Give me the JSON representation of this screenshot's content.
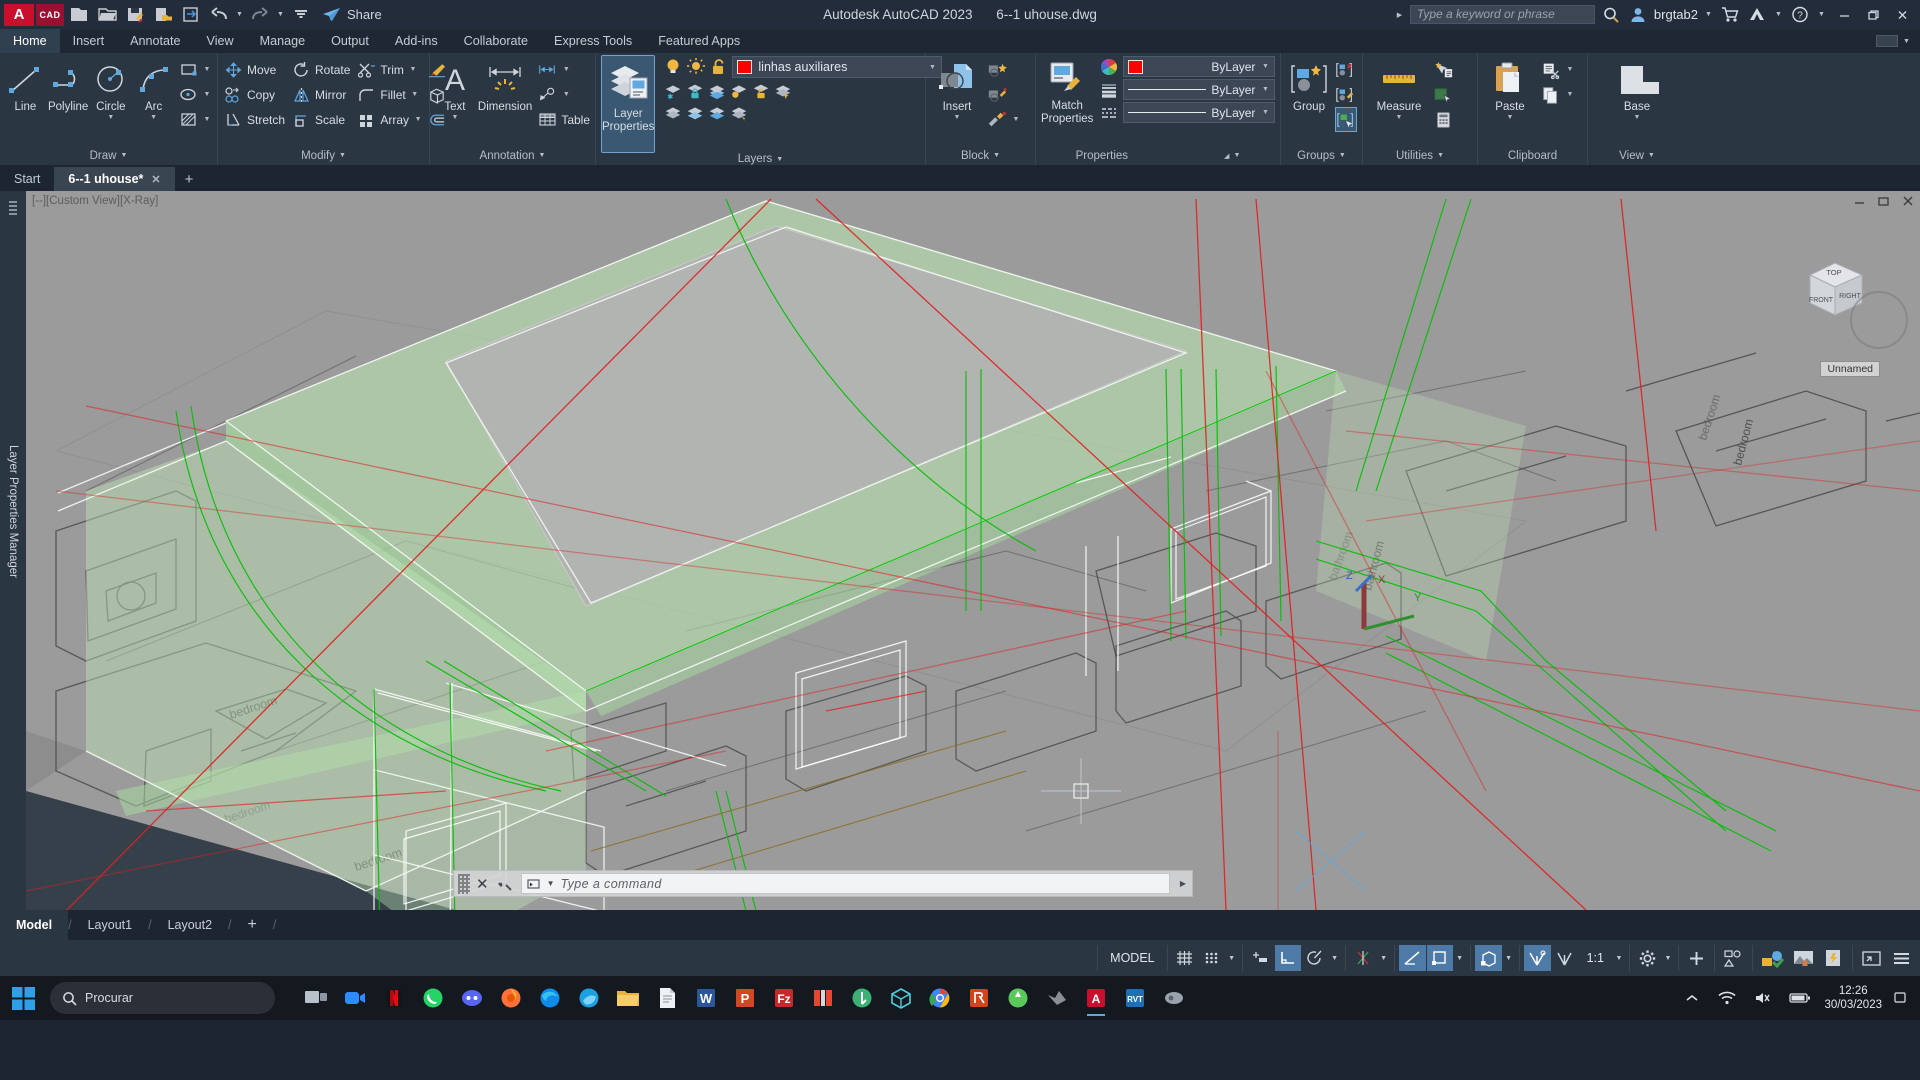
{
  "titlebar": {
    "logo": "A",
    "logo_cad": "CAD",
    "quick_access": [
      {
        "name": "new-file-icon",
        "label": "New"
      },
      {
        "name": "open-file-icon",
        "label": "Open"
      },
      {
        "name": "save-icon",
        "label": "Save"
      },
      {
        "name": "save-as-icon",
        "label": "Save As"
      },
      {
        "name": "plot-icon",
        "label": "Plot"
      },
      {
        "name": "undo-icon",
        "label": "Undo"
      },
      {
        "name": "redo-icon",
        "label": "Redo"
      },
      {
        "name": "qat-more-icon",
        "label": "Customize Quick Access Toolbar"
      }
    ],
    "share_label": "Share",
    "app_title": "Autodesk AutoCAD 2023",
    "document_name": "6--1 uhouse.dwg",
    "search_placeholder": "Type a keyword or phrase",
    "username": "brgtab2",
    "window_buttons": [
      "minimize",
      "restore",
      "close"
    ]
  },
  "ribbon_tabs": {
    "items": [
      "Home",
      "Insert",
      "Annotate",
      "View",
      "Manage",
      "Output",
      "Add-ins",
      "Collaborate",
      "Express Tools",
      "Featured Apps"
    ],
    "active": "Home"
  },
  "ribbon": {
    "panels": [
      {
        "title": "Draw",
        "big": [
          {
            "label": "Line",
            "icon": "line-icon",
            "dropdown": false
          },
          {
            "label": "Polyline",
            "icon": "polyline-icon",
            "dropdown": false
          },
          {
            "label": "Circle",
            "icon": "circle-icon",
            "dropdown": true
          },
          {
            "label": "Arc",
            "icon": "arc-icon",
            "dropdown": true
          }
        ],
        "small": [
          {
            "label": "",
            "icon": "rectangle-icon",
            "dropdown": true
          },
          {
            "label": "",
            "icon": "ellipse-icon",
            "dropdown": true
          },
          {
            "label": "",
            "icon": "hatch-icon",
            "dropdown": true
          }
        ]
      },
      {
        "title": "Modify",
        "small": [
          {
            "label": "Move",
            "icon": "move-icon"
          },
          {
            "label": "Rotate",
            "icon": "rotate-icon"
          },
          {
            "label": "Trim",
            "icon": "trim-icon",
            "dropdown": true
          },
          {
            "label": "Copy",
            "icon": "copy-icon"
          },
          {
            "label": "Mirror",
            "icon": "mirror-icon"
          },
          {
            "label": "Fillet",
            "icon": "fillet-icon",
            "dropdown": true
          },
          {
            "label": "Stretch",
            "icon": "stretch-icon"
          },
          {
            "label": "Scale",
            "icon": "scale-icon"
          },
          {
            "label": "Array",
            "icon": "array-icon",
            "dropdown": true
          }
        ],
        "extra": [
          {
            "label": "",
            "icon": "brush-icon"
          },
          {
            "label": "",
            "icon": "3d-box-icon"
          },
          {
            "label": "",
            "icon": "offset-icon"
          }
        ]
      },
      {
        "title": "Annotation",
        "big": [
          {
            "label": "Text",
            "icon": "text-icon",
            "dropdown": true
          },
          {
            "label": "Dimension",
            "icon": "dimension-icon",
            "dropdown": false
          }
        ],
        "small": [
          {
            "label": "",
            "icon": "linear-dim-icon",
            "dropdown": true
          },
          {
            "label": "",
            "icon": "leader-icon",
            "dropdown": true
          },
          {
            "label": "Table",
            "icon": "table-icon"
          }
        ]
      },
      {
        "title": "Layers",
        "big": [
          {
            "label": "Layer Properties",
            "icon": "layer-properties-icon",
            "active": true
          }
        ],
        "layer_combo": {
          "color": "#ff0000",
          "name": "linhas auxiliares",
          "toggles": [
            "lightbulb-on-icon",
            "sun-icon",
            "unlock-icon"
          ]
        },
        "layer_tools": [
          "layer-freeze-icon",
          "layer-lock-icon",
          "layer-merge-icon",
          "layer-isolate-icon",
          "layer-unlock-icon",
          "layer-match-icon",
          "layer-off-icon",
          "layer-on-icon",
          "layer-previous-icon",
          "layer-walk-icon"
        ]
      },
      {
        "title": "Block",
        "big": [
          {
            "label": "Insert",
            "icon": "insert-block-icon",
            "dropdown": true
          }
        ],
        "small": [
          {
            "label": "",
            "icon": "create-block-icon"
          },
          {
            "label": "",
            "icon": "edit-block-icon"
          },
          {
            "label": "",
            "icon": "edit-attribute-icon",
            "dropdown": true
          }
        ]
      },
      {
        "title": "Properties",
        "big": [
          {
            "label": "Match Properties",
            "icon": "match-properties-icon"
          }
        ],
        "combos": [
          {
            "icon": "color-wheel-icon",
            "swatch": "#ff0000",
            "value": "ByLayer",
            "name": "object-color"
          },
          {
            "icon": "lineweight-icon",
            "value": "ByLayer",
            "name": "lineweight"
          },
          {
            "icon": "linetype-icon",
            "value": "ByLayer",
            "name": "linetype"
          }
        ]
      },
      {
        "title": "Groups",
        "big": [
          {
            "label": "Group",
            "icon": "group-icon"
          }
        ],
        "small": [
          {
            "label": "",
            "icon": "ungroup-icon"
          },
          {
            "label": "",
            "icon": "group-edit-icon"
          },
          {
            "label": "",
            "icon": "group-selection-icon",
            "active": true
          }
        ]
      },
      {
        "title": "Utilities",
        "big": [
          {
            "label": "Measure",
            "icon": "measure-icon",
            "dropdown": true
          }
        ],
        "small": [
          {
            "label": "",
            "icon": "quick-select-icon"
          },
          {
            "label": "",
            "icon": "quick-calc-area-icon"
          },
          {
            "label": "",
            "icon": "calculator-icon"
          }
        ]
      },
      {
        "title": "Clipboard",
        "big": [
          {
            "label": "Paste",
            "icon": "paste-icon",
            "dropdown": true
          }
        ],
        "small": [
          {
            "label": "",
            "icon": "cut-icon",
            "dropdown": true
          },
          {
            "label": "",
            "icon": "copy-clip-icon",
            "dropdown": true
          }
        ]
      },
      {
        "title": "View",
        "big": [
          {
            "label": "Base",
            "icon": "base-view-icon",
            "dropdown": true
          }
        ]
      }
    ]
  },
  "doc_tabs": {
    "items": [
      {
        "label": "Start",
        "closable": false,
        "active": false
      },
      {
        "label": "6--1 uhouse*",
        "closable": true,
        "active": true
      }
    ],
    "add_label": "+"
  },
  "viewport": {
    "label": "[--][Custom View][X-Ray]",
    "viewcube_faces": {
      "top": "TOP",
      "front": "FRONT",
      "right": "RIGHT"
    },
    "unnamed_label": "Unnamed",
    "ucs_axes": [
      "X",
      "Y",
      "Z"
    ],
    "room_labels": [
      "bedroom",
      "bedroom",
      "bathroom",
      "bedroom"
    ]
  },
  "command_line": {
    "placeholder": "Type a command",
    "close_label": "✕"
  },
  "layout_tabs": {
    "items": [
      "Model",
      "Layout1",
      "Layout2"
    ],
    "active": "Model",
    "add_label": "+"
  },
  "status_bar": {
    "space_label": "MODEL",
    "scale": "1:1",
    "buttons": [
      {
        "name": "grid-display-toggle",
        "on": false
      },
      {
        "name": "snap-mode-toggle",
        "on": false
      },
      {
        "name": "infer-constraints-toggle",
        "on": false
      },
      {
        "name": "ortho-mode-toggle",
        "on": true
      },
      {
        "name": "polar-tracking-toggle",
        "on": false
      },
      {
        "name": "object-snap-tracking-toggle",
        "on": false
      },
      {
        "name": "object-snap-toggle",
        "on": true
      },
      {
        "name": "show-annotation-objects-toggle",
        "on": true
      },
      {
        "name": "3d-object-snap-toggle",
        "on": true
      },
      {
        "name": "dynamic-ucs-toggle",
        "on": true
      },
      {
        "name": "selection-cycling-toggle",
        "on": false
      },
      {
        "name": "annotation-scale",
        "on": false
      },
      {
        "name": "workspace-settings",
        "on": false
      },
      {
        "name": "customization",
        "on": false
      },
      {
        "name": "isolate-objects",
        "on": false
      },
      {
        "name": "hardware-acceleration",
        "on": false
      },
      {
        "name": "clean-screen",
        "on": false
      }
    ]
  },
  "taskbar": {
    "start_label": "Start",
    "search_placeholder": "Procurar",
    "apps": [
      {
        "name": "task-view-icon"
      },
      {
        "name": "zoom-app-icon"
      },
      {
        "name": "netflix-icon"
      },
      {
        "name": "whatsapp-icon"
      },
      {
        "name": "discord-icon"
      },
      {
        "name": "firefox-icon"
      },
      {
        "name": "edge-icon"
      },
      {
        "name": "browser-icon"
      },
      {
        "name": "file-explorer-icon"
      },
      {
        "name": "notepad-icon"
      },
      {
        "name": "word-icon"
      },
      {
        "name": "powerpoint-icon"
      },
      {
        "name": "filezilla-icon"
      },
      {
        "name": "sketchup-icon"
      },
      {
        "name": "qbittorrent-icon"
      },
      {
        "name": "3dsmax-icon"
      },
      {
        "name": "chrome-icon"
      },
      {
        "name": "revit-icon"
      },
      {
        "name": "photoshop-icon"
      },
      {
        "name": "spotify-icon"
      },
      {
        "name": "autocad-icon"
      },
      {
        "name": "autocad-rvt-icon"
      },
      {
        "name": "app-icon"
      }
    ],
    "tray": [
      "chevron-up-icon",
      "wifi-icon",
      "volume-icon",
      "battery-icon"
    ],
    "time": "12:26",
    "date": "30/03/2023"
  }
}
